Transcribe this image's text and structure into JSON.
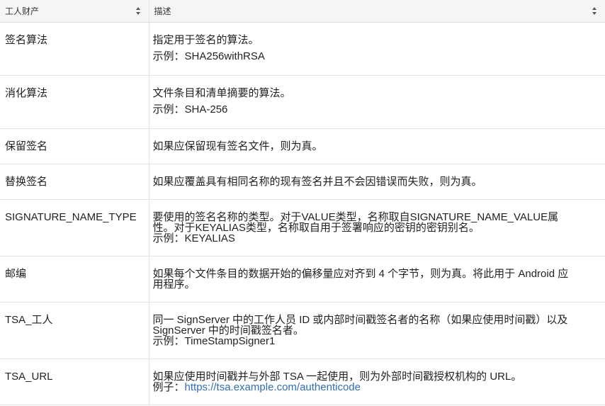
{
  "table": {
    "headers": [
      "工人财产",
      "描述"
    ],
    "rows": [
      {
        "name": "签名算法",
        "desc": [
          "指定用于签名的算法。"
        ],
        "example_label": "示例：",
        "example": "SHA256withRSA"
      },
      {
        "name": "消化算法",
        "desc": [
          "文件条目和清单摘要的算法。"
        ],
        "example_label": "示例：",
        "example": "SHA-256"
      },
      {
        "name": "保留签名",
        "desc": [
          "如果应保留现有签名文件，则为真。"
        ]
      },
      {
        "name": "替换签名",
        "desc": [
          "如果应覆盖具有相同名称的现有签名并且不会因错误而失败，则为真。"
        ]
      },
      {
        "name": "SIGNATURE_NAME_TYPE",
        "desc": [
          "要使用的签名名称的类型。对于VALUE类型，名称取自SIGNATURE_NAME_VALUE属",
          "性。对于KEYALIAS类型，名称取自用于签署响应的密钥的密钥别名。"
        ],
        "example_label": "示例：",
        "example": "KEYALIAS"
      },
      {
        "name": "邮编",
        "desc": [
          "如果每个文件条目的数据开始的偏移量应对齐到 4 个字节，则为真。将此用于 Android 应",
          "用程序。"
        ]
      },
      {
        "name": "TSA_工人",
        "desc": [
          "同一 SignServer 中的工作人员 ID 或内部时间戳签名者的名称（如果应使用时间戳）以及",
          "SignServer 中的时间戳签名者。"
        ],
        "example_label": "示例：",
        "example": "TimeStampSigner1"
      },
      {
        "name": "TSA_URL",
        "desc": [
          "如果应使用时间戳并与外部 TSA 一起使用，则为外部时间戳授权机构的 URL。"
        ],
        "example_label": "例子：",
        "example": "https://tsa.example.com/authenticode",
        "example_is_link": true
      }
    ]
  }
}
